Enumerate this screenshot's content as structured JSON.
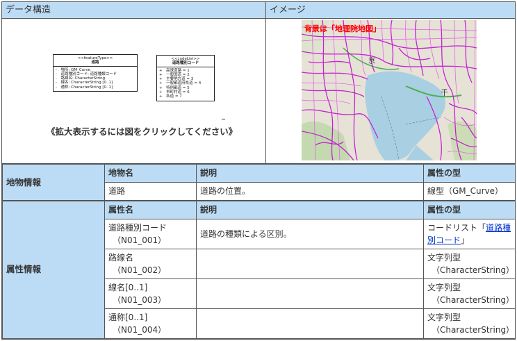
{
  "header": {
    "data_structure": "データ構造",
    "image": "イメージ"
  },
  "uml_feature": {
    "stereotype": "<<featureType>>",
    "name": "道路",
    "attrs": [
      "-　場所: GM_Curve",
      "-　道路種別コード: 道路種類コード",
      "-　路線名: CharacterString",
      "-　線名: CharacterString [0..1]",
      "-　通称: CharacterString [0..1]"
    ]
  },
  "uml_codelist": {
    "stereotype": "<<codeList>>",
    "name": "道路種別コード",
    "items": [
      "+　高速道路 = 1",
      "+　一般国道 = 2",
      "+　主要地方道 = 3",
      "+　一般都道府県道 = 4",
      "+　特例都道 = 5",
      "+　市町村道 = 6",
      "+　私道 = 7"
    ]
  },
  "caption": "《拡大表示するには図をクリックしてください》",
  "map": {
    "label": "背景は「地理院地図」",
    "place_kyo": "京",
    "place_chi": "千"
  },
  "feature_info": {
    "side_label": "地物情報",
    "col_name": "地物名",
    "col_desc": "説明",
    "col_type": "属性の型",
    "name": "道路",
    "desc": "道路の位置。",
    "type": "線型（GM_Curve）"
  },
  "attribute_info": {
    "side_label": "属性情報",
    "col_name": "属性名",
    "col_desc": "説明",
    "col_type": "属性の型",
    "rows": [
      {
        "name": "道路種別コード",
        "code": "（N01_001）",
        "desc": "道路の種類による区別。",
        "type_prefix": "コードリスト「",
        "type_link": "道路種別コード",
        "type_suffix": "」"
      },
      {
        "name": "路線名",
        "code": "（N01_002）",
        "desc": "",
        "type_line1": "文字列型",
        "type_line2": "（CharacterString）"
      },
      {
        "name": "線名[0..1]",
        "code": "（N01_003）",
        "desc": "",
        "type_line1": "文字列型",
        "type_line2": "（CharacterString）"
      },
      {
        "name": "通称[0..1]",
        "code": "（N01_004）",
        "desc": "",
        "type_line1": "文字列型",
        "type_line2": "（CharacterString）"
      }
    ]
  }
}
